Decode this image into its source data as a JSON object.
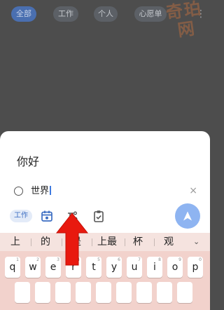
{
  "tabs": [
    {
      "label": "全部",
      "active": true
    },
    {
      "label": "工作",
      "active": false
    },
    {
      "label": "个人",
      "active": false
    },
    {
      "label": "心愿单",
      "active": false
    }
  ],
  "more_icon": "⋮",
  "watermark": {
    "line1": "奇珀",
    "line2": "网"
  },
  "sheet": {
    "title": "你好",
    "subtask": "世界",
    "clear_icon": "×",
    "chip_label": "工作",
    "icons": [
      "calendar-icon",
      "subtask-icon",
      "clipboard-icon"
    ],
    "send_icon": "send-icon"
  },
  "keyboard": {
    "candidates": [
      "上",
      "的",
      "是",
      "上最",
      "杯",
      "观"
    ],
    "expand_icon": "⌄",
    "row1": [
      {
        "k": "q",
        "n": "1"
      },
      {
        "k": "w",
        "n": "2"
      },
      {
        "k": "e",
        "n": "3"
      },
      {
        "k": "r",
        "n": "4"
      },
      {
        "k": "t",
        "n": "5"
      },
      {
        "k": "y",
        "n": "6"
      },
      {
        "k": "u",
        "n": "7"
      },
      {
        "k": "i",
        "n": "8"
      },
      {
        "k": "o",
        "n": "9"
      },
      {
        "k": "p",
        "n": "0"
      }
    ],
    "row2": [
      "",
      "",
      "",
      "",
      "",
      "",
      "",
      "",
      ""
    ]
  },
  "colors": {
    "overlay": "#4d4d4d",
    "accent": "#3f7be0",
    "send_button": "#8eb4f1",
    "arrow": "#e8190f",
    "keyboard_bg": "#f2d2cc"
  }
}
